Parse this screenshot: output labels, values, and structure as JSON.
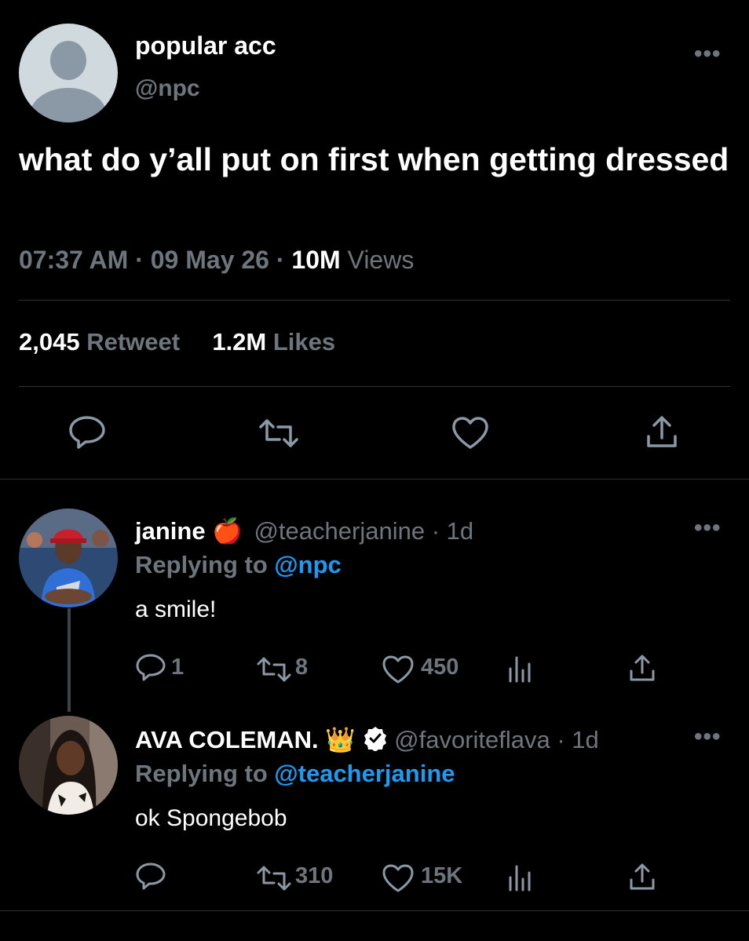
{
  "main_tweet": {
    "display_name": "popular acc",
    "handle": "@npc",
    "text": "what do y’all put on first when getting dressed",
    "time": "07:37 AM",
    "sep1": "·",
    "date": "09 May 26",
    "sep2": "·",
    "views_count": "10M",
    "views_label": "Views",
    "retweets_count": "2,045",
    "retweets_label": "Retweet",
    "likes_count": "1.2M",
    "likes_label": "Likes",
    "more_label": "•••"
  },
  "replies": [
    {
      "display_name": "janine",
      "emoji": "🍎",
      "handle": "@teacherjanine",
      "age": "· 1d",
      "replying_prefix": "Replying to",
      "replying_to": "@npc",
      "text": "a smile!",
      "reply_count": "1",
      "retweet_count": "8",
      "like_count": "450",
      "more_label": "•••"
    },
    {
      "display_name": "AVA COLEMAN.",
      "emoji": "👑",
      "handle": "@favoriteflava",
      "age": "· 1d",
      "replying_prefix": "Replying to",
      "replying_to": "@teacherjanine",
      "text": "ok Spongebob",
      "reply_count": "",
      "retweet_count": "310",
      "like_count": "15K",
      "more_label": "•••"
    }
  ],
  "icons": {
    "reply": "reply-icon",
    "retweet": "retweet-icon",
    "like": "heart-icon",
    "share": "share-icon",
    "analytics": "analytics-icon",
    "verified": "verified-badge-icon"
  },
  "colors": {
    "background": "#000000",
    "text": "#ffffff",
    "muted": "#6e767d",
    "link": "#1d9bf0",
    "divider": "#2f3336"
  }
}
